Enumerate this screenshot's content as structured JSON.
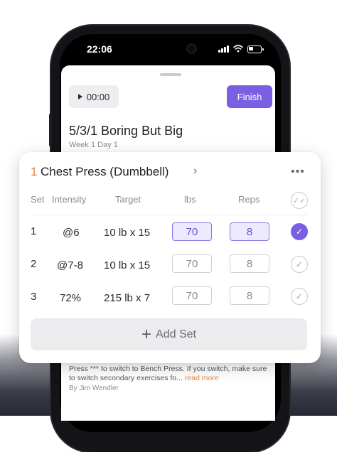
{
  "status_bar": {
    "time": "22:06"
  },
  "workout": {
    "timer_label": "00:00",
    "finish_label": "Finish",
    "title": "5/3/1 Boring But Big",
    "subtitle": "Week 1 Day 1"
  },
  "exercise": {
    "index": "1",
    "name": "Chest Press (Dumbbell)",
    "chevron": "›",
    "menu": "•••",
    "columns": {
      "set": "Set",
      "intensity": "Intensity",
      "target": "Target",
      "weight": "lbs",
      "reps": "Reps"
    },
    "sets": [
      {
        "set": "1",
        "intensity": "@6",
        "target": "10 lb x 15",
        "weight": "70",
        "reps": "8",
        "completed": true
      },
      {
        "set": "2",
        "intensity": "@7-8",
        "target": "10 lb x 15",
        "weight": "70",
        "reps": "8",
        "completed": false
      },
      {
        "set": "3",
        "intensity": "72%",
        "target": "215 lb x 7",
        "weight": "70",
        "reps": "8",
        "completed": false
      }
    ],
    "add_set_label": "Add Set"
  },
  "note": {
    "text": "Press *** to switch to Bench Press. If you switch, make sure to switch secondary exercises fo...",
    "more_label": "read more",
    "author": "By Jim Wendler"
  },
  "colors": {
    "accent": "#7b5fe3",
    "index_orange": "#e8833a"
  },
  "icons": [
    "play-icon",
    "chevron-right-icon",
    "more-icon",
    "double-check-icon",
    "check-icon",
    "plus-icon",
    "wifi-icon",
    "battery-icon",
    "signal-icon"
  ]
}
